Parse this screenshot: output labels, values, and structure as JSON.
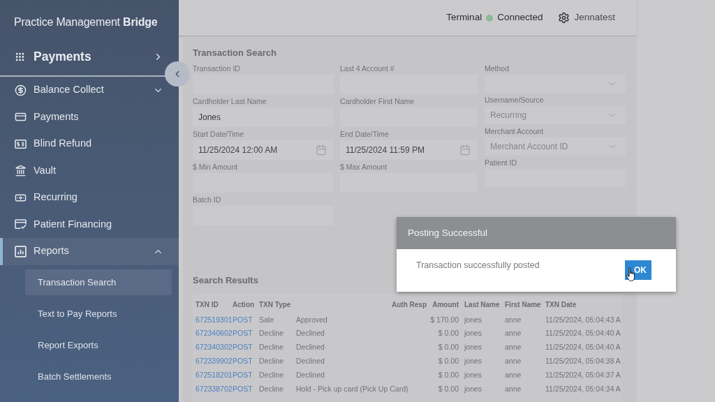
{
  "sidebar": {
    "logo": "Practice Management **Bridge**",
    "section": "Payments",
    "items": [
      {
        "label": "Balance Collect",
        "kind": "group",
        "expanded": false,
        "selected": false
      },
      {
        "label": "Payments",
        "kind": "link",
        "selected": false
      },
      {
        "label": "Blind Refund",
        "kind": "link",
        "selected": false
      },
      {
        "label": "Vault",
        "kind": "link",
        "selected": false
      },
      {
        "label": "Recurring",
        "kind": "link",
        "selected": false
      },
      {
        "label": "Patient Financing",
        "kind": "link",
        "selected": false
      },
      {
        "label": "Reports",
        "kind": "group",
        "expanded": true,
        "selected": true,
        "children": [
          {
            "label": "Transaction Search",
            "selected": true
          },
          {
            "label": "Text to Pay Reports",
            "selected": false
          },
          {
            "label": "Report Exports",
            "selected": false
          },
          {
            "label": "Batch Settlements",
            "selected": false
          }
        ]
      }
    ]
  },
  "header": {
    "terminal": "Terminal",
    "connected": true,
    "status": "Connected",
    "user": "Jennatest"
  },
  "search": {
    "title": "Transaction Search",
    "fields": [
      {
        "label": "Transaction ID",
        "kind": "text"
      },
      {
        "label": "Last 4 Account #",
        "kind": "text"
      },
      {
        "label": "Cardholder Last Name",
        "kind": "text",
        "value": "Jones"
      },
      {
        "label": "Cardholder First Name",
        "kind": "text"
      },
      {
        "label": "Start Date/Time",
        "kind": "date",
        "value": "11/25/2024 12:00 AM"
      },
      {
        "label": "End Date/Time",
        "kind": "date",
        "value": "11/25/2024 11:59 PM"
      },
      {
        "label": "$ Min Amount",
        "kind": "text"
      },
      {
        "label": "$ Max Amount",
        "kind": "text"
      },
      {
        "label": "Batch ID",
        "kind": "text"
      }
    ],
    "side_fields": [
      {
        "label": "Method",
        "kind": "select"
      },
      {
        "label": "Username/Source",
        "kind": "select",
        "placeholder": "Recurring"
      },
      {
        "label": "Merchant Account",
        "kind": "select",
        "placeholder": "Merchant Account ID"
      },
      {
        "label": "Patient ID",
        "kind": "text"
      }
    ]
  },
  "results": {
    "title": "Search Results",
    "columns": [
      "TXN ID",
      "Action",
      "TXN Type",
      "Auth Resp",
      "Amount",
      "Last Name",
      "First Name",
      "TXN Date"
    ],
    "rows": [
      {
        "cells": [
          "672519301",
          "POST",
          "Sale",
          "Approved",
          "$ 170.00",
          "jones",
          "anne",
          "11/25/2024, 05:04:43 A"
        ]
      },
      {
        "cells": [
          "672340602",
          "POST",
          "Decline",
          "Declined",
          "$ 0.00",
          "jones",
          "anne",
          "11/25/2024, 05:04:40 A"
        ]
      },
      {
        "cells": [
          "672340302",
          "POST",
          "Decline",
          "Declined",
          "$ 0.00",
          "jones",
          "anne",
          "11/25/2024, 05:04:40 A"
        ]
      },
      {
        "cells": [
          "672339902",
          "POST",
          "Decline",
          "Declined",
          "$ 0.00",
          "jones",
          "anne",
          "11/25/2024, 05:04:38 A"
        ]
      },
      {
        "cells": [
          "672518201",
          "POST",
          "Decline",
          "Declined",
          "$ 0.00",
          "jones",
          "anne",
          "11/25/2024, 05:04:37 A"
        ]
      },
      {
        "cells": [
          "672338702",
          "POST",
          "Decline",
          "Hold - Pick up card (Pick Up Card)",
          "$ 0.00",
          "jones",
          "anne",
          "11/25/2024, 05:04:34 A"
        ]
      }
    ]
  },
  "dialog": {
    "title": "Posting Successful",
    "message": "Transaction successfully posted",
    "button": "OK"
  }
}
